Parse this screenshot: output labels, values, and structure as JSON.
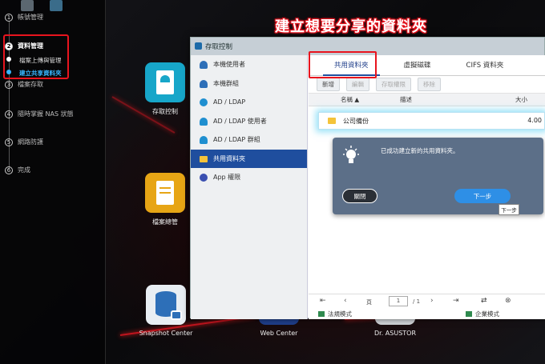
{
  "banner": "建立想要分享的資料夾",
  "sidebar": {
    "steps": [
      {
        "num": "1",
        "label": "帳號管理"
      },
      {
        "num": "2",
        "label": "資料管理"
      },
      {
        "num": "3",
        "label": "檔案存取"
      },
      {
        "num": "4",
        "label": "隨時掌握 NAS 狀態"
      },
      {
        "num": "5",
        "label": "網路防護"
      },
      {
        "num": "6",
        "label": "完成"
      }
    ],
    "substeps": [
      "檔案上傳與管理",
      "建立共享資料夾"
    ]
  },
  "desktop": {
    "apps": [
      "存取控制",
      "檔案總管",
      "Snapshot Center",
      "Web Center",
      "Dr. ASUSTOR"
    ]
  },
  "window": {
    "title": "存取控制",
    "nav": [
      "本機使用者",
      "本機群組",
      "AD / LDAP",
      "AD / LDAP 使用者",
      "AD / LDAP 群組",
      "共用資料夾",
      "App 權限"
    ],
    "tabs": [
      "共用資料夾",
      "虛擬磁碟",
      "CIFS 資料夾"
    ],
    "toolbar": [
      "新增",
      "編輯",
      "存取權限",
      "移除"
    ],
    "columns": [
      "名稱",
      "描述",
      "大小"
    ],
    "row": {
      "name": "公司備份",
      "size": "4.00"
    },
    "dialog": {
      "message": "已成功建立新的共用資料夾。",
      "close": "關閉",
      "next": "下一步",
      "tooltip": "下一步"
    },
    "pager": {
      "page_label": "頁",
      "page": "1",
      "of": "/ 1"
    },
    "footer": {
      "left": "法規模式",
      "right": "企業模式"
    }
  },
  "colors": {
    "accent": "#1f4e9e",
    "highlight": "#e8141e",
    "next": "#2e8fe6"
  }
}
